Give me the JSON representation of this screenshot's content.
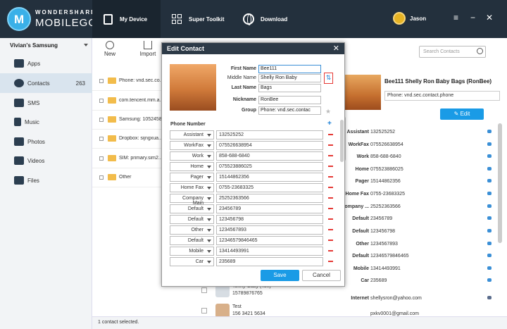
{
  "app": {
    "brand_line1": "WONDERSHARE",
    "brand_line2": "MOBILEGO",
    "logo_letter": "M",
    "user": "Jason"
  },
  "tabs": [
    {
      "label": "My Device"
    },
    {
      "label": "Super Toolkit"
    },
    {
      "label": "Download"
    }
  ],
  "window_controls": {
    "menu": "≡",
    "minimize": "−",
    "close": "✕"
  },
  "sidebar": {
    "device": "Vivian's Samsung",
    "items": [
      {
        "label": "Apps",
        "count": ""
      },
      {
        "label": "Contacts",
        "count": "263"
      },
      {
        "label": "SMS",
        "count": ""
      },
      {
        "label": "Music",
        "count": ""
      },
      {
        "label": "Photos",
        "count": ""
      },
      {
        "label": "Videos",
        "count": ""
      },
      {
        "label": "Files",
        "count": ""
      }
    ]
  },
  "toolbar": {
    "new_label": "New",
    "import_label": "Import"
  },
  "accounts": [
    {
      "label": "Phone: vnd.sec.co..."
    },
    {
      "label": "com.tencent.mm.a..."
    },
    {
      "label": "Samsung: 1052458..."
    },
    {
      "label": "Dropbox: sijngxua..."
    },
    {
      "label": "SIM: primary.sim2..."
    },
    {
      "label": "Other"
    }
  ],
  "search": {
    "placeholder": "Search Contacts"
  },
  "detail": {
    "name": "Bee111 Shelly Ron Baby Bags (RonBee)",
    "account": "Phone: vnd.sec.contact.phone",
    "edit_label": "Edit",
    "rows": [
      {
        "label": "Assistant",
        "value": "132525252"
      },
      {
        "label": "WorkFax",
        "value": "075526638954"
      },
      {
        "label": "Work",
        "value": "858-688-6840"
      },
      {
        "label": "Home",
        "value": "075523886025"
      },
      {
        "label": "Pager",
        "value": "15144862356"
      },
      {
        "label": "Home Fax",
        "value": "0755-23683325"
      },
      {
        "label": "Company ...",
        "value": "25252363566"
      },
      {
        "label": "Default",
        "value": "23456789"
      },
      {
        "label": "Default",
        "value": "123456798"
      },
      {
        "label": "Other",
        "value": "1234567893"
      },
      {
        "label": "Default",
        "value": "12346579846465"
      },
      {
        "label": "Mobile",
        "value": "13414493991"
      },
      {
        "label": "Car",
        "value": "235689"
      }
    ],
    "internet_label": "Internet",
    "internet_value": "shellysron@yahoo.com",
    "email2": "pxkv0001@gmail.com"
  },
  "modal": {
    "title": "Edit Contact",
    "close": "✕",
    "first_name_label": "First Name",
    "first_name": "Bee111",
    "middle_name_label": "Middle Name",
    "middle_name": "Shelly Ron Baby",
    "last_name_label": "Last Name",
    "last_name": "Bags",
    "nickname_label": "Nickname",
    "nickname": "RonBee",
    "group_label": "Group",
    "group": "Phone: vnd.sec.contac",
    "phone_header": "Phone Number",
    "phones": [
      {
        "type": "Assistant",
        "value": "132525252"
      },
      {
        "type": "WorkFax",
        "value": "075526638954"
      },
      {
        "type": "Work",
        "value": "858-688-6840"
      },
      {
        "type": "Home",
        "value": "075523886025"
      },
      {
        "type": "Pager",
        "value": "15144862356"
      },
      {
        "type": "Home Fax",
        "value": "0755-23683325"
      },
      {
        "type": "Company Main",
        "value": "25252363566"
      },
      {
        "type": "Default",
        "value": "23456789"
      },
      {
        "type": "Default",
        "value": "123456798"
      },
      {
        "type": "Other",
        "value": "1234567893"
      },
      {
        "type": "Default",
        "value": "12346579846465"
      },
      {
        "type": "Mobile",
        "value": "13414493991"
      },
      {
        "type": "Car",
        "value": "235689"
      }
    ],
    "save_label": "Save",
    "cancel_label": "Cancel"
  },
  "contacts_partial": [
    {
      "name": "Tenny  Gasy (Ten)",
      "phone": "15789876765"
    },
    {
      "name": "Test",
      "phone": "156 3421 5634"
    }
  ],
  "status": "1 contact selected.",
  "colors": {
    "topbar": "#23303d",
    "accent": "#1a9be6",
    "delete": "#e53935"
  }
}
